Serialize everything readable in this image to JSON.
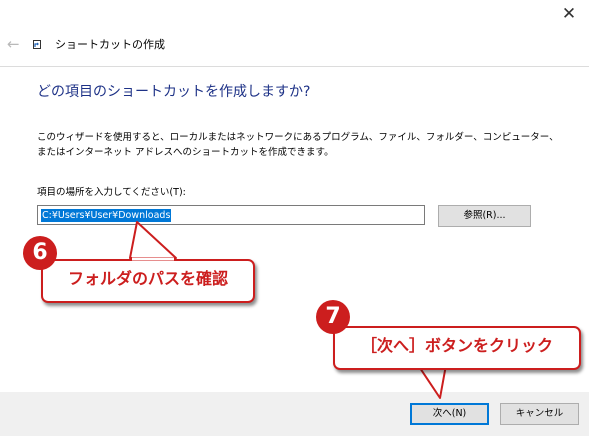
{
  "window": {
    "close_glyph": "✕",
    "back_glyph": "←",
    "title": "ショートカットの作成"
  },
  "main": {
    "heading": "どの項目のショートカットを作成しますか?",
    "description": "このウィザードを使用すると、ローカルまたはネットワークにあるプログラム、ファイル、フォルダー、コンピューター、またはインターネット アドレスへのショートカットを作成できます。",
    "location_label": "項目の場所を入力してください(T):",
    "location_value": "C:¥Users¥User¥Downloads",
    "browse_label": "参照(R)..."
  },
  "footer": {
    "next_label": "次へ(N)",
    "cancel_label": "キャンセル"
  },
  "annotations": {
    "step1_number": "6",
    "step1_text": "フォルダのパスを確認",
    "step2_number": "7",
    "step2_text": "［次へ］ボタンをクリック",
    "accent_color": "#cc1e1e"
  },
  "colors": {
    "heading": "#1e3287",
    "selection": "#0078d7"
  },
  "icons": {
    "back": "back-arrow-icon",
    "close": "close-icon",
    "shortcut": "shortcut-icon"
  }
}
